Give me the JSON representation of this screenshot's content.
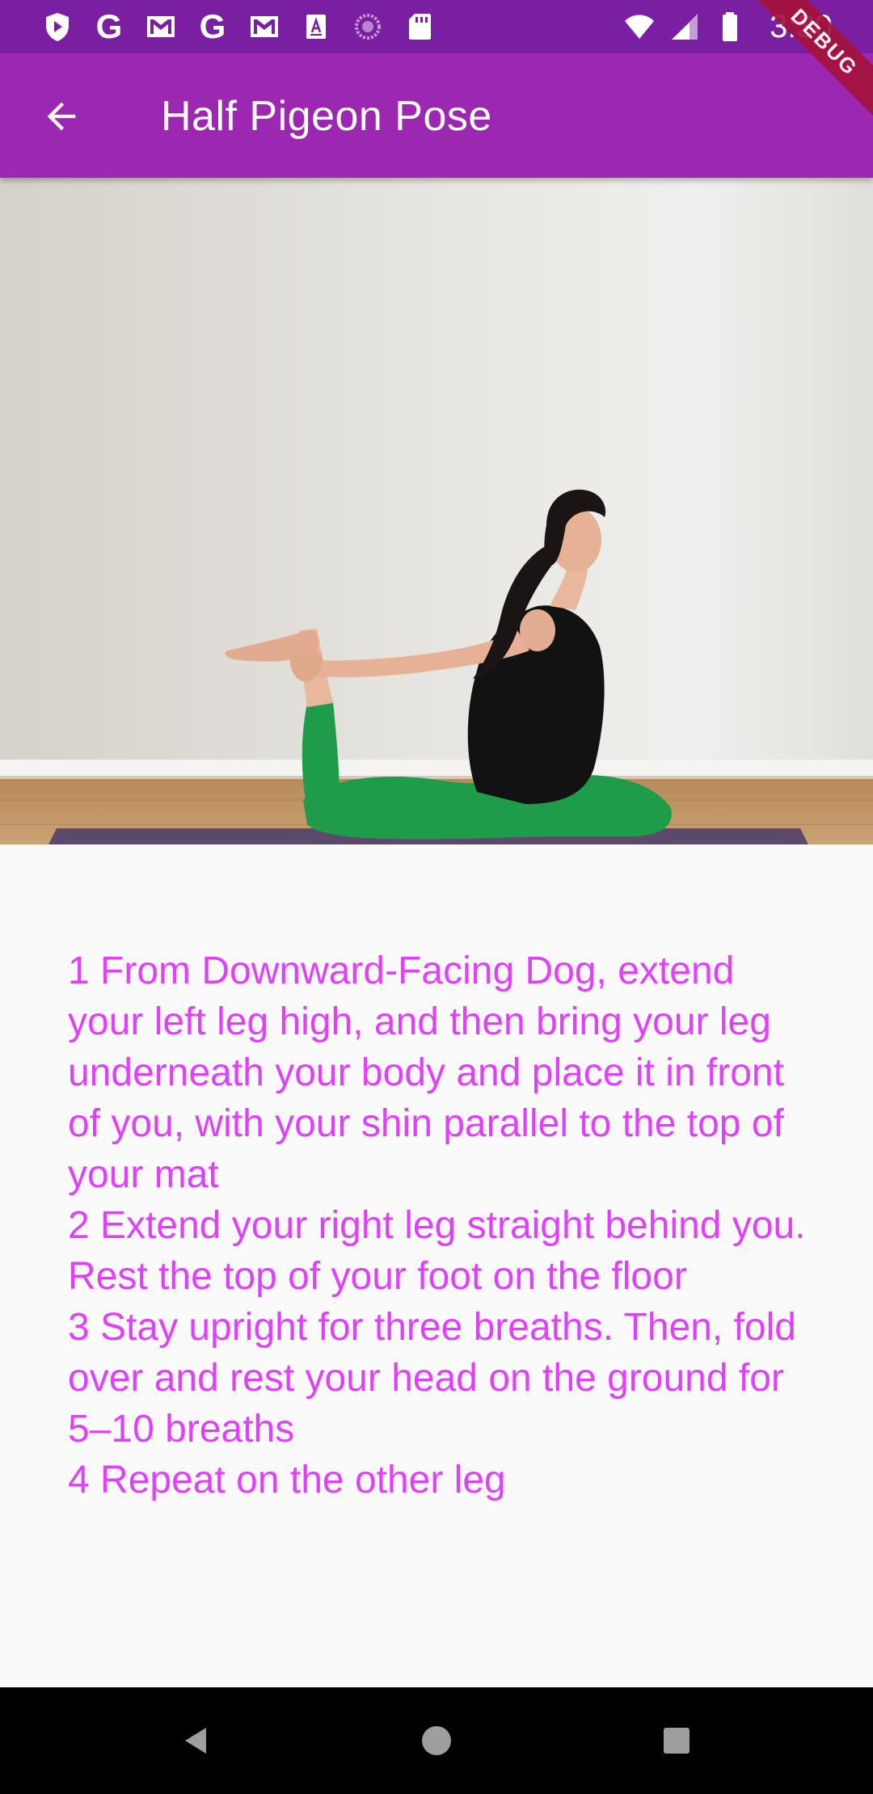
{
  "status_bar": {
    "time": "3:30",
    "icons": [
      "shield-icon",
      "google-icon",
      "gmail-icon",
      "google-icon",
      "gmail-icon",
      "font-app-icon",
      "sync-icon",
      "sd-card-icon",
      "wifi-icon",
      "signal-icon",
      "battery-icon"
    ],
    "google_glyph": "G"
  },
  "app_bar": {
    "title": "Half Pigeon Pose",
    "back_icon": "arrow-back-icon"
  },
  "debug_banner": "DEBUG",
  "instructions": [
    "1 From Downward-Facing Dog, extend your left leg high, and then bring your leg underneath your body and place it in front of you, with your shin parallel to the top of your mat",
    "2 Extend your right leg straight behind you. Rest the top of your foot on the floor",
    "3 Stay upright for three breaths. Then, fold over and rest your head on the ground for 5–10 breaths",
    "4 Repeat on the other leg"
  ],
  "colors": {
    "status_bar": "#7b1fa2",
    "app_bar": "#9c27b0",
    "instruction_text": "#e040fb",
    "background": "#fafafa",
    "nav_bar": "#000000"
  },
  "nav_bar": {
    "buttons": [
      "back-triangle-icon",
      "home-circle-icon",
      "recents-square-icon"
    ]
  }
}
